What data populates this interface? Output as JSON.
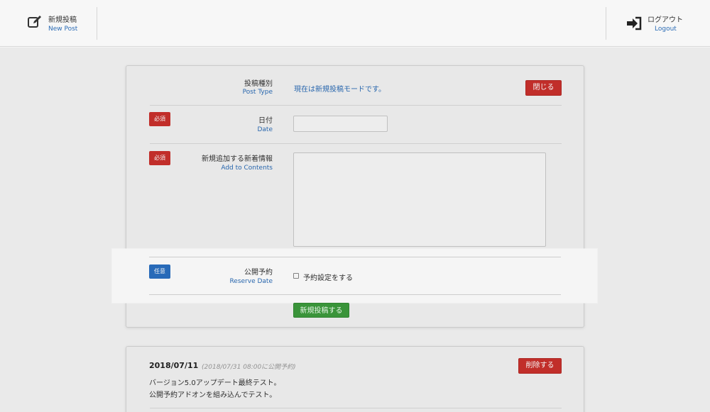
{
  "header": {
    "new_post": {
      "ja": "新規投稿",
      "en": "New Post",
      "icon": "edit-icon"
    },
    "logout": {
      "ja": "ログアウト",
      "en": "Logout",
      "icon": "logout-icon"
    }
  },
  "form": {
    "post_type": {
      "ja": "投稿種別",
      "en": "Post Type",
      "value": "現在は新規投稿モードです。"
    },
    "close_label": "閉じる",
    "date": {
      "badge": "必須",
      "ja": "日付",
      "en": "Date",
      "value": ""
    },
    "contents": {
      "badge": "必須",
      "ja": "新規追加する新着情報",
      "en": "Add to Contents",
      "value": ""
    },
    "reserve": {
      "badge": "任意",
      "ja": "公開予約",
      "en": "Reserve Date",
      "checkbox_label": "予約設定をする",
      "checked": false
    },
    "submit_label": "新規投稿する"
  },
  "post": {
    "date": "2018/07/11",
    "schedule": "(2018/07/31 08:00に公開予約)",
    "delete_label": "削除する",
    "line1": "バージョン5.0アップデート最終テスト。",
    "line2": "公開予約アドオンを組み込んでテスト。"
  },
  "colors": {
    "accent": "#2a6bb5",
    "danger": "#c9302c",
    "success": "#3d9b3d",
    "info": "#2a6fc0"
  }
}
